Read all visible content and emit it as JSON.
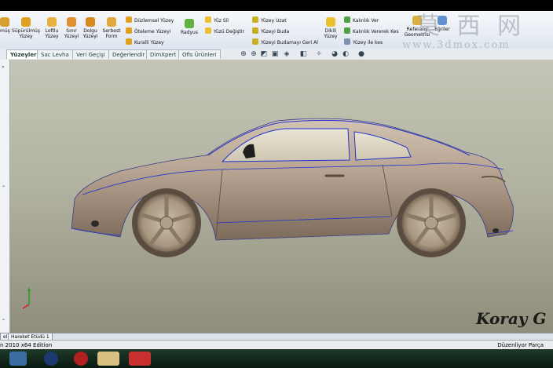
{
  "ribbon": {
    "buttons": [
      {
        "label": "müş",
        "color": "#d8a030"
      },
      {
        "label": "Süpürülmüş Yüzey",
        "color": "#e0a020"
      },
      {
        "label": "Loftlu Yüzey",
        "color": "#e8b040"
      },
      {
        "label": "Sınır Yüzeyi",
        "color": "#e09030"
      },
      {
        "label": "Dolgu Yüzeyi",
        "color": "#d88a20"
      },
      {
        "label": "Serbest Form",
        "color": "#e0a840"
      },
      {
        "label": "Radyus",
        "color": "#60b040"
      },
      {
        "label": "Dikili Yüzey",
        "color": "#e8c030"
      },
      {
        "label": "Referans Geometrisi",
        "color": "#d8b040"
      },
      {
        "label": "Eğriler",
        "color": "#6090d0"
      }
    ],
    "small_items": [
      {
        "label": "Düzlemsel Yüzey",
        "color": "#e0a020"
      },
      {
        "label": "Öteleme Yüzeyi",
        "color": "#e0a020"
      },
      {
        "label": "Kuralli Yüzey",
        "color": "#e0a020"
      },
      {
        "label": "Yüz Sil",
        "color": "#e8c030"
      },
      {
        "label": "Yüzü Değiştir",
        "color": "#e8c030"
      },
      {
        "label": "Yüzey Uzat",
        "color": "#c8b020"
      },
      {
        "label": "Yüzeyi Buda",
        "color": "#c8b020"
      },
      {
        "label": "Yüzeyi Budamayı Geri Al",
        "color": "#c8b020"
      },
      {
        "label": "Kalınlık Ver",
        "color": "#50a040"
      },
      {
        "label": "Kalınlık Vererek Kes",
        "color": "#50a040"
      },
      {
        "label": "Yüzey ile kes",
        "color": "#8090b0"
      }
    ]
  },
  "tabs": [
    "Yüzeyler",
    "Sac Levha",
    "Veri Geçişi",
    "Değerlendir",
    "DimXpert",
    "Ofis Ürünleri"
  ],
  "left_marks": [
    "»",
    "⌃",
    "⌃"
  ],
  "bottom_tabs": [
    "el",
    "Hareket Etüdü 1"
  ],
  "status": {
    "left": "n 2010 x64 Edition",
    "right": "Düzenliyor Parça"
  },
  "watermark": {
    "line1": "莫 西 网",
    "line2": "www.3dmox.com"
  },
  "signature": "Koray G",
  "colors": {
    "accent": "#2a4a8a",
    "car_body": "#b8a592",
    "edge_lines": "#2233cc"
  }
}
